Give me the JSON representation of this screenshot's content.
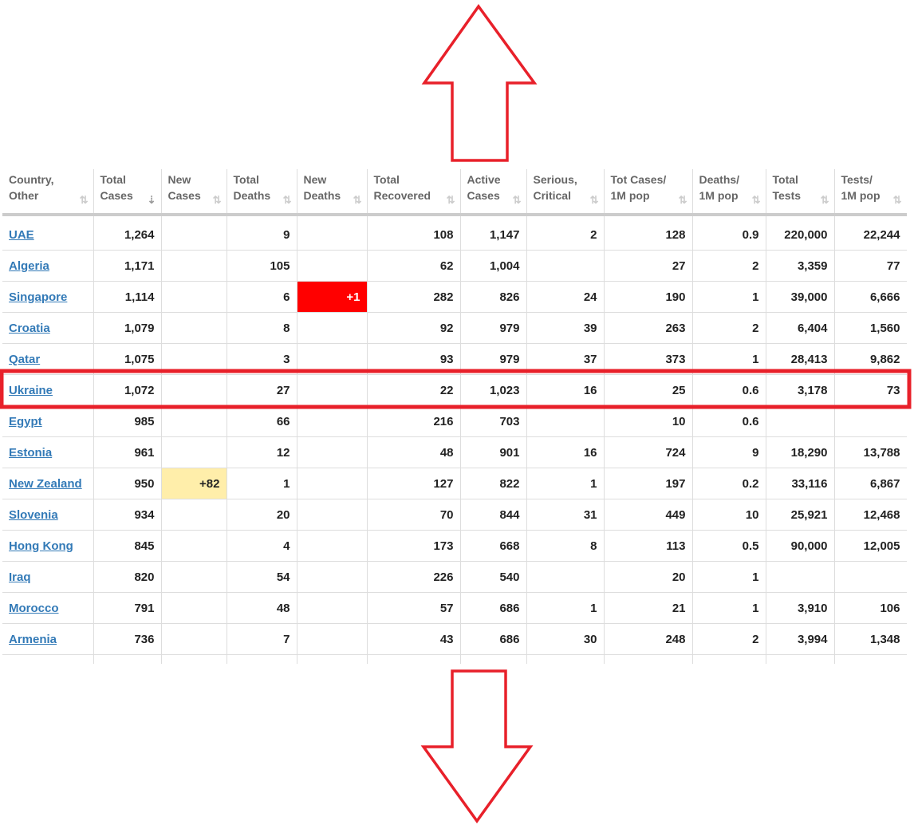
{
  "columns": [
    {
      "l1": "Country,",
      "l2": "Other"
    },
    {
      "l1": "Total",
      "l2": "Cases"
    },
    {
      "l1": "New",
      "l2": "Cases"
    },
    {
      "l1": "Total",
      "l2": "Deaths"
    },
    {
      "l1": "New",
      "l2": "Deaths"
    },
    {
      "l1": "Total",
      "l2": "Recovered"
    },
    {
      "l1": "Active",
      "l2": "Cases"
    },
    {
      "l1": "Serious,",
      "l2": "Critical"
    },
    {
      "l1": "Tot Cases/",
      "l2": "1M pop"
    },
    {
      "l1": "Deaths/",
      "l2": "1M pop"
    },
    {
      "l1": "Total",
      "l2": "Tests"
    },
    {
      "l1": "Tests/",
      "l2": "1M pop"
    }
  ],
  "sort_icon": "sort-arrows-icon",
  "rows": [
    [
      "UAE",
      "1,264",
      "",
      "9",
      "",
      "108",
      "1,147",
      "2",
      "128",
      "0.9",
      "220,000",
      "22,244"
    ],
    [
      "Algeria",
      "1,171",
      "",
      "105",
      "",
      "62",
      "1,004",
      "",
      "27",
      "2",
      "3,359",
      "77"
    ],
    [
      "Singapore",
      "1,114",
      "",
      "6",
      "+1",
      "282",
      "826",
      "24",
      "190",
      "1",
      "39,000",
      "6,666"
    ],
    [
      "Croatia",
      "1,079",
      "",
      "8",
      "",
      "92",
      "979",
      "39",
      "263",
      "2",
      "6,404",
      "1,560"
    ],
    [
      "Qatar",
      "1,075",
      "",
      "3",
      "",
      "93",
      "979",
      "37",
      "373",
      "1",
      "28,413",
      "9,862"
    ],
    [
      "Ukraine",
      "1,072",
      "",
      "27",
      "",
      "22",
      "1,023",
      "16",
      "25",
      "0.6",
      "3,178",
      "73"
    ],
    [
      "Egypt",
      "985",
      "",
      "66",
      "",
      "216",
      "703",
      "",
      "10",
      "0.6",
      "",
      ""
    ],
    [
      "Estonia",
      "961",
      "",
      "12",
      "",
      "48",
      "901",
      "16",
      "724",
      "9",
      "18,290",
      "13,788"
    ],
    [
      "New Zealand",
      "950",
      "+82",
      "1",
      "",
      "127",
      "822",
      "1",
      "197",
      "0.2",
      "33,116",
      "6,867"
    ],
    [
      "Slovenia",
      "934",
      "",
      "20",
      "",
      "70",
      "844",
      "31",
      "449",
      "10",
      "25,921",
      "12,468"
    ],
    [
      "Hong Kong",
      "845",
      "",
      "4",
      "",
      "173",
      "668",
      "8",
      "113",
      "0.5",
      "90,000",
      "12,005"
    ],
    [
      "Iraq",
      "820",
      "",
      "54",
      "",
      "226",
      "540",
      "",
      "20",
      "1",
      "",
      ""
    ],
    [
      "Morocco",
      "791",
      "",
      "48",
      "",
      "57",
      "686",
      "1",
      "21",
      "1",
      "3,910",
      "106"
    ],
    [
      "Armenia",
      "736",
      "",
      "7",
      "",
      "43",
      "686",
      "30",
      "248",
      "2",
      "3,994",
      "1,348"
    ]
  ],
  "highlighted_row": "Ukraine",
  "colors": {
    "annotation": "#e8202a",
    "new_cases_bg": "#ffeeaa",
    "new_deaths_bg": "#ff0000",
    "link": "#337ab7"
  }
}
